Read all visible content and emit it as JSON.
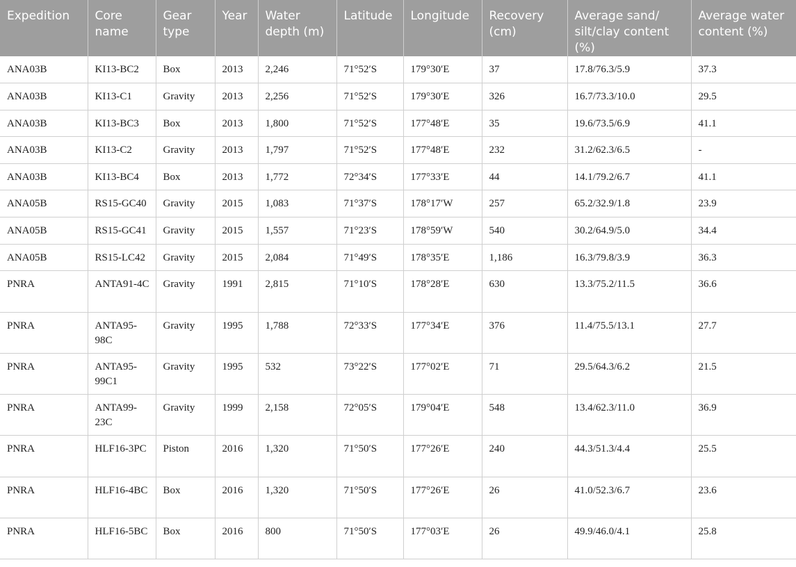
{
  "headers": [
    "Expedition",
    "Core name",
    "Gear type",
    "Year",
    "Water depth (m)",
    "Latitude",
    "Longitude",
    "Recovery (cm)",
    "Average sand/ silt/clay content (%)",
    "Average water content (%)"
  ],
  "rows": [
    [
      "ANA03B",
      "KI13-BC2",
      "Box",
      "2013",
      "2,246",
      "71°52′S",
      "179°30′E",
      "37",
      "17.8/76.3/5.9",
      "37.3"
    ],
    [
      "ANA03B",
      "KI13-C1",
      "Gravity",
      "2013",
      "2,256",
      "71°52′S",
      "179°30′E",
      "326",
      "16.7/73.3/10.0",
      "29.5"
    ],
    [
      "ANA03B",
      "KI13-BC3",
      "Box",
      "2013",
      "1,800",
      "71°52′S",
      "177°48′E",
      "35",
      "19.6/73.5/6.9",
      "41.1"
    ],
    [
      "ANA03B",
      "KI13-C2",
      "Gravity",
      "2013",
      "1,797",
      "71°52′S",
      "177°48′E",
      "232",
      "31.2/62.3/6.5",
      "-"
    ],
    [
      "ANA03B",
      "KI13-BC4",
      "Box",
      "2013",
      "1,772",
      "72°34′S",
      "177°33′E",
      "44",
      "14.1/79.2/6.7",
      "41.1"
    ],
    [
      "ANA05B",
      "RS15-GC40",
      "Gravity",
      "2015",
      "1,083",
      "71°37′S",
      "178°17′W",
      "257",
      "65.2/32.9/1.8",
      "23.9"
    ],
    [
      "ANA05B",
      "RS15-GC41",
      "Gravity",
      "2015",
      "1,557",
      "71°23′S",
      "178°59′W",
      "540",
      "30.2/64.9/5.0",
      "34.4"
    ],
    [
      "ANA05B",
      "RS15-LC42",
      "Gravity",
      "2015",
      "2,084",
      "71°49′S",
      "178°35′E",
      "1,186",
      "16.3/79.8/3.9",
      "36.3"
    ],
    [
      "PNRA",
      "ANTA91-4C",
      "Gravity",
      "1991",
      "2,815",
      "71°10′S",
      "178°28′E",
      "630",
      "13.3/75.2/11.5",
      "36.6"
    ],
    [
      "PNRA",
      "ANTA95-98C",
      "Gravity",
      "1995",
      "1,788",
      "72°33′S",
      "177°34′E",
      "376",
      "11.4/75.5/13.1",
      "27.7"
    ],
    [
      "PNRA",
      "ANTA95-99C1",
      "Gravity",
      "1995",
      "532",
      "73°22′S",
      "177°02′E",
      "71",
      "29.5/64.3/6.2",
      "21.5"
    ],
    [
      "PNRA",
      "ANTA99-23C",
      "Gravity",
      "1999",
      "2,158",
      "72°05′S",
      "179°04′E",
      "548",
      "13.4/62.3/11.0",
      "36.9"
    ],
    [
      "PNRA",
      "HLF16-3PC",
      "Piston",
      "2016",
      "1,320",
      "71°50′S",
      "177°26′E",
      "240",
      "44.3/51.3/4.4",
      "25.5"
    ],
    [
      "PNRA",
      "HLF16-4BC",
      "Box",
      "2016",
      "1,320",
      "71°50′S",
      "177°26′E",
      "26",
      "41.0/52.3/6.7",
      "23.6"
    ],
    [
      "PNRA",
      "HLF16-5BC",
      "Box",
      "2016",
      "800",
      "71°50′S",
      "177°03′E",
      "26",
      "49.9/46.0/4.1",
      "25.8"
    ]
  ]
}
